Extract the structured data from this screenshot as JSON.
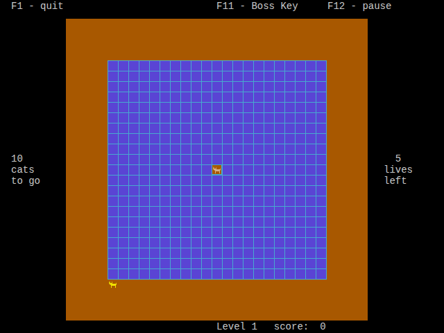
{
  "header": {
    "quit": "F1 - quit",
    "boss_key": "F11 - Boss Key",
    "pause": "F12 - pause"
  },
  "cats_remaining": {
    "count": "10",
    "line1": "cats",
    "line2": "to go"
  },
  "lives": {
    "count": "5",
    "line1": "lives",
    "line2": "left"
  },
  "status_bar": {
    "level": "Level 1",
    "score_label": "score:",
    "score": "0"
  },
  "field": {
    "columns": 29,
    "rows": 29,
    "sea": {
      "col": 4,
      "row": 4,
      "columns": 21,
      "rows": 21
    }
  },
  "enemies": [
    {
      "kind": "cat",
      "col": 14,
      "row": 14
    }
  ],
  "player": {
    "col": 4,
    "row": 25
  }
}
